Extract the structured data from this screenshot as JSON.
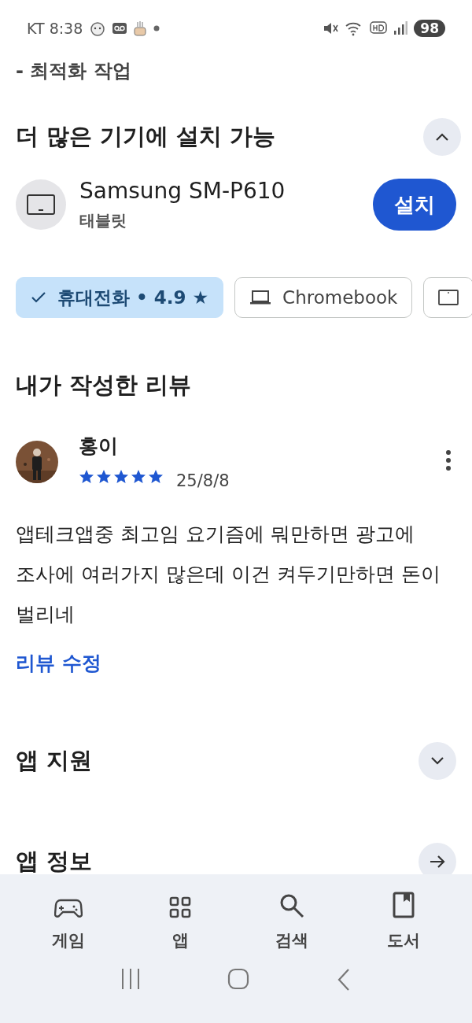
{
  "status_bar": {
    "carrier_time": "KT 8:38",
    "battery": "98"
  },
  "release_notes": {
    "line": "- 최적화 작업"
  },
  "install_section": {
    "title": "더 많은 기기에 설치 가능",
    "expanded": true,
    "device": {
      "name": "Samsung SM-P610",
      "type": "태블릿",
      "button": "설치"
    },
    "chips": [
      {
        "kind": "phone",
        "label": "휴대전화 • 4.9 ★",
        "selected": true
      },
      {
        "kind": "laptop",
        "label": "Chromebook",
        "selected": false
      },
      {
        "kind": "tablet",
        "selected": false
      }
    ]
  },
  "my_review": {
    "title": "내가 작성한 리뷰",
    "author": "홍이",
    "stars": 5,
    "date": "25/8/8",
    "text": "앱테크앱중 최고임 요기즘에 뭐만하면 광고에 조사에 여러가지 많은데 이건 켜두기만하면 돈이 벌리네",
    "edit_link": "리뷰 수정"
  },
  "sections": [
    {
      "kind": "expand",
      "title": "앱 지원",
      "expanded": false
    },
    {
      "kind": "link",
      "title": "앱 정보"
    }
  ],
  "bottom_nav": [
    {
      "kind": "games",
      "label": "게임",
      "selected": false
    },
    {
      "kind": "apps",
      "label": "앱",
      "selected": false
    },
    {
      "kind": "search",
      "label": "검색",
      "selected": false
    },
    {
      "kind": "books",
      "label": "도서",
      "selected": false
    }
  ]
}
